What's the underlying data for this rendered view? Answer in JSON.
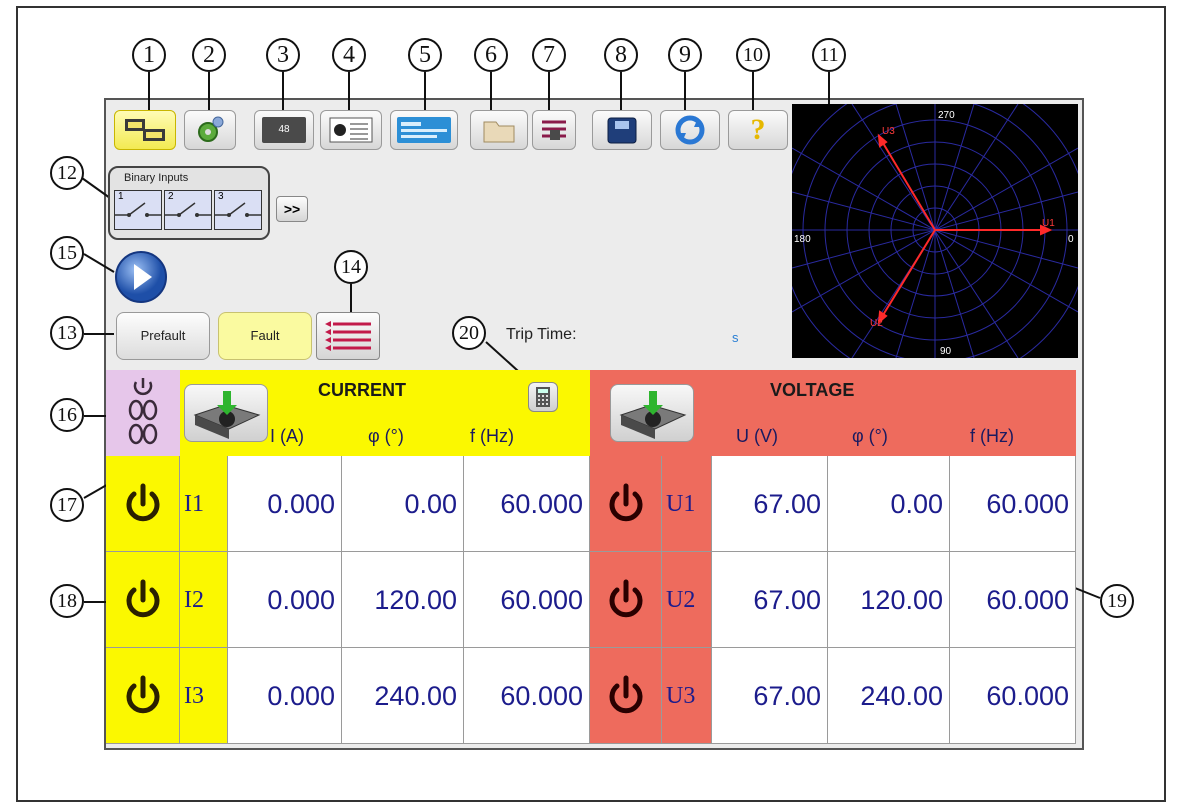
{
  "callouts": [
    "1",
    "2",
    "3",
    "4",
    "5",
    "6",
    "7",
    "8",
    "9",
    "10",
    "11",
    "12",
    "13",
    "14",
    "15",
    "16",
    "17",
    "18",
    "19",
    "20"
  ],
  "toolbar": {
    "buttons": [
      {
        "icon": "network-config-icon",
        "active": true
      },
      {
        "icon": "settings-gear-icon"
      },
      {
        "icon": "battery-icon",
        "label": "48"
      },
      {
        "icon": "test-report-icon"
      },
      {
        "icon": "test-card-icon"
      },
      {
        "icon": "folder-icon"
      },
      {
        "icon": "sequence-list-icon"
      },
      {
        "icon": "save-disk-icon"
      },
      {
        "icon": "refresh-icon"
      },
      {
        "icon": "help-icon",
        "label": "?"
      }
    ]
  },
  "binary_inputs": {
    "title": "Binary Inputs",
    "inputs": [
      "1",
      "2",
      "3"
    ],
    "more_label": ">>"
  },
  "modes": {
    "prefault": "Prefault",
    "fault": "Fault"
  },
  "trip": {
    "label": "Trip Time:",
    "unit": "s"
  },
  "polar": {
    "labels": {
      "top": "270",
      "left": "180",
      "right": "0",
      "bottom": "90"
    },
    "vectors": [
      {
        "name": "U1",
        "angle": 0
      },
      {
        "name": "U2",
        "angle": 120
      },
      {
        "name": "U3",
        "angle": 240
      }
    ],
    "vector_color": "#ff2a2a",
    "grid_color": "#2a2aa0"
  },
  "current": {
    "title": "CURRENT",
    "cols": [
      "I (A)",
      "φ  (°)",
      "f  (Hz)"
    ],
    "rows": [
      {
        "name": "I1",
        "amp": "0.000",
        "phase": "0.00",
        "freq": "60.000"
      },
      {
        "name": "I2",
        "amp": "0.000",
        "phase": "120.00",
        "freq": "60.000"
      },
      {
        "name": "I3",
        "amp": "0.000",
        "phase": "240.00",
        "freq": "60.000"
      }
    ]
  },
  "voltage": {
    "title": "VOLTAGE",
    "cols": [
      "U  (V)",
      "φ  (°)",
      "f  (Hz)"
    ],
    "rows": [
      {
        "name": "U1",
        "amp": "67.00",
        "phase": "0.00",
        "freq": "60.000"
      },
      {
        "name": "U2",
        "amp": "67.00",
        "phase": "120.00",
        "freq": "60.000"
      },
      {
        "name": "U3",
        "amp": "67.00",
        "phase": "240.00",
        "freq": "60.000"
      }
    ]
  },
  "colors": {
    "current": "#fbf800",
    "voltage": "#ee6b5d",
    "link": "#e6c6ea",
    "value_text": "#1c1c8c"
  }
}
